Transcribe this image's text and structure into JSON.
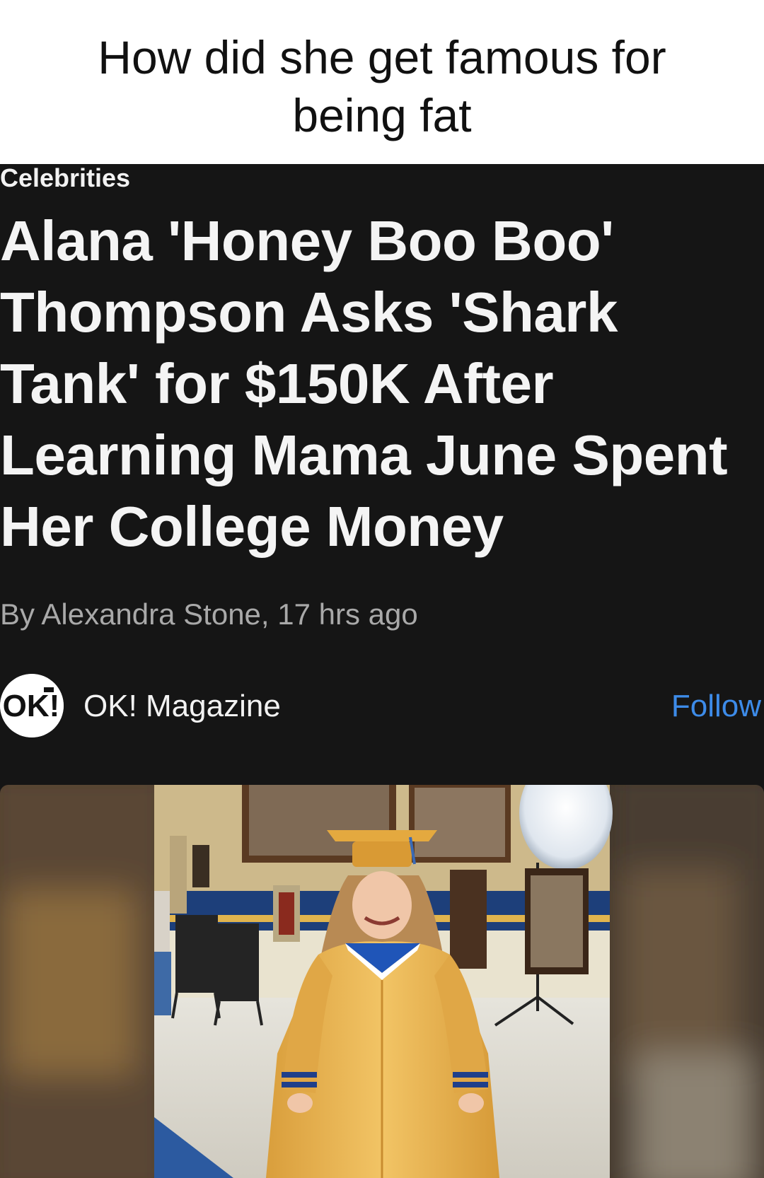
{
  "meme": {
    "caption": "How did she get famous for being fat"
  },
  "article": {
    "category": "Celebrities",
    "headline": "Alana 'Honey Boo Boo' Thompson Asks 'Shark Tank' for $150K After Learning Mama June Spent Her College Money",
    "byline": "By Alexandra Stone, 17 hrs ago",
    "publisher": {
      "logo_icon": "ok-magazine-logo",
      "logo_text": "OK!",
      "name": "OK! Magazine",
      "follow_label": "Follow"
    },
    "photo": {
      "subject": "graduate-photo"
    }
  },
  "colors": {
    "page_bg": "#151515",
    "caption_bg": "#ffffff",
    "follow_blue": "#3d8be8",
    "gown_gold": "#e8b24e"
  }
}
